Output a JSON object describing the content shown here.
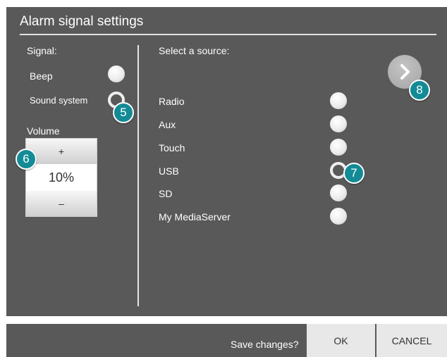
{
  "dialog": {
    "title": "Alarm signal settings"
  },
  "signal": {
    "heading": "Signal:",
    "options": [
      {
        "label": "Beep",
        "selected": false
      },
      {
        "label": "Sound system",
        "selected": true
      }
    ]
  },
  "volume": {
    "heading": "Volume",
    "increase_label": "+",
    "value": "10%",
    "decrease_label": "–"
  },
  "source": {
    "heading": "Select a source:",
    "options": [
      {
        "label": "Radio",
        "selected": false
      },
      {
        "label": "Aux",
        "selected": false
      },
      {
        "label": "Touch",
        "selected": false
      },
      {
        "label": "USB",
        "selected": true
      },
      {
        "label": "SD",
        "selected": false
      },
      {
        "label": "My MediaServer",
        "selected": false
      }
    ]
  },
  "callouts": [
    "5",
    "6",
    "7",
    "8"
  ],
  "footer": {
    "prompt": "Save changes?",
    "ok_label": "OK",
    "cancel_label": "CANCEL"
  },
  "colors": {
    "panel": "#595959",
    "callout": "#138b96",
    "button": "#e8e8e8"
  },
  "icons": {
    "next": "chevron-right-icon"
  }
}
